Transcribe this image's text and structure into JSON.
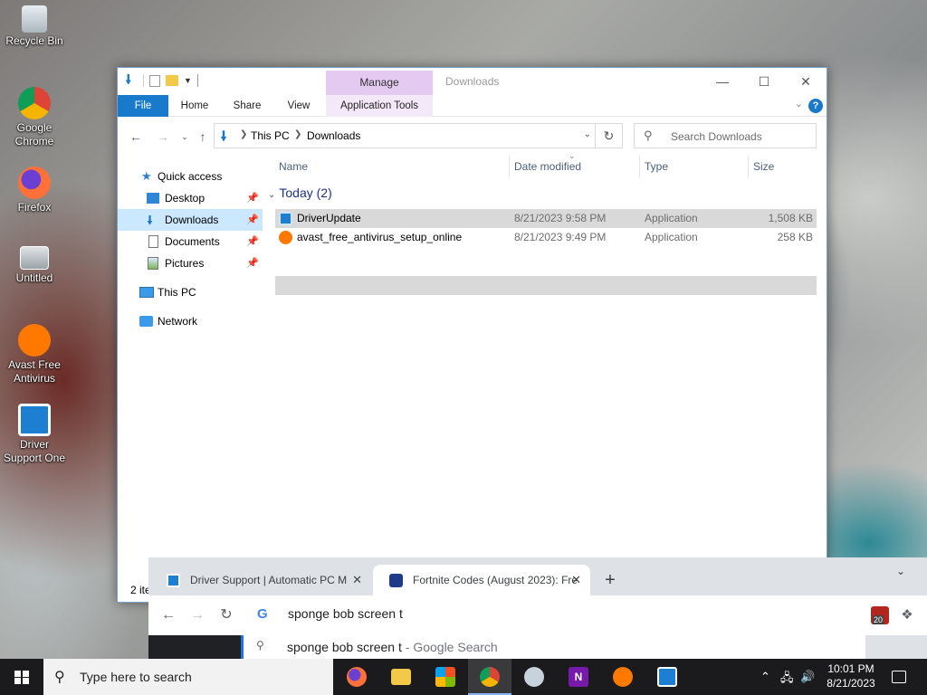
{
  "desktop": {
    "icons": [
      {
        "label": "Recycle Bin",
        "icon": "recycle-bin-icon"
      },
      {
        "label": "Google Chrome",
        "icon": "chrome-icon"
      },
      {
        "label": "Firefox",
        "icon": "firefox-icon"
      },
      {
        "label": "Untitled",
        "icon": "image-file-icon"
      },
      {
        "label": "Avast Free Antivirus",
        "icon": "avast-icon"
      },
      {
        "label": "Driver Support One",
        "icon": "driver-support-icon"
      }
    ]
  },
  "explorer": {
    "title": "Downloads",
    "manage_tab": "Manage",
    "ribbon_tabs": [
      "File",
      "Home",
      "Share",
      "View",
      "Application Tools"
    ],
    "breadcrumb": [
      "This PC",
      "Downloads"
    ],
    "search_placeholder": "Search Downloads",
    "sidebar": [
      {
        "label": "Quick access",
        "icon": "star-icon",
        "pinned": false
      },
      {
        "label": "Desktop",
        "icon": "desktop-folder-icon",
        "pinned": true
      },
      {
        "label": "Downloads",
        "icon": "download-arrow-icon",
        "pinned": true,
        "selected": true
      },
      {
        "label": "Documents",
        "icon": "documents-icon",
        "pinned": true
      },
      {
        "label": "Pictures",
        "icon": "pictures-icon",
        "pinned": true
      },
      {
        "label": "This PC",
        "icon": "computer-icon",
        "pinned": false
      },
      {
        "label": "Network",
        "icon": "network-icon",
        "pinned": false
      }
    ],
    "columns": [
      "Name",
      "Date modified",
      "Type",
      "Size"
    ],
    "group_label": "Today (2)",
    "files": [
      {
        "name": "DriverUpdate",
        "date": "8/21/2023 9:58 PM",
        "type": "Application",
        "size": "1,508 KB",
        "icon": "driver-update-icon",
        "selected": true
      },
      {
        "name": "avast_free_antivirus_setup_online",
        "date": "8/21/2023 9:49 PM",
        "type": "Application",
        "size": "258 KB",
        "icon": "avast-setup-icon",
        "selected": false
      }
    ],
    "status": "2 ite"
  },
  "chrome": {
    "tabs": [
      {
        "title": "Driver Support | Automatic PC M",
        "icon": "driver-support-favicon",
        "active": false
      },
      {
        "title": "Fortnite Codes (August 2023): Fre",
        "icon": "fortnite-favicon",
        "active": true
      }
    ],
    "omnibox_text": "sponge bob screen t",
    "suggestion_query": "sponge bob screen t",
    "suggestion_suffix": " - Google Search",
    "extension_badge": "20"
  },
  "taskbar": {
    "search_placeholder": "Type here to search",
    "apps": [
      "firefox-icon",
      "file-explorer-icon",
      "store-icon",
      "chrome-icon",
      "snipping-icon",
      "onenote-icon",
      "avast-icon",
      "driver-support-icon"
    ],
    "active_app": "chrome-icon",
    "time": "10:01 PM",
    "date": "8/21/2023"
  },
  "colors": {
    "accent": "#1979ca",
    "manage_tab": "#e4c9f1",
    "selection": "#cce8ff",
    "taskbar": "#1b1b1d"
  }
}
